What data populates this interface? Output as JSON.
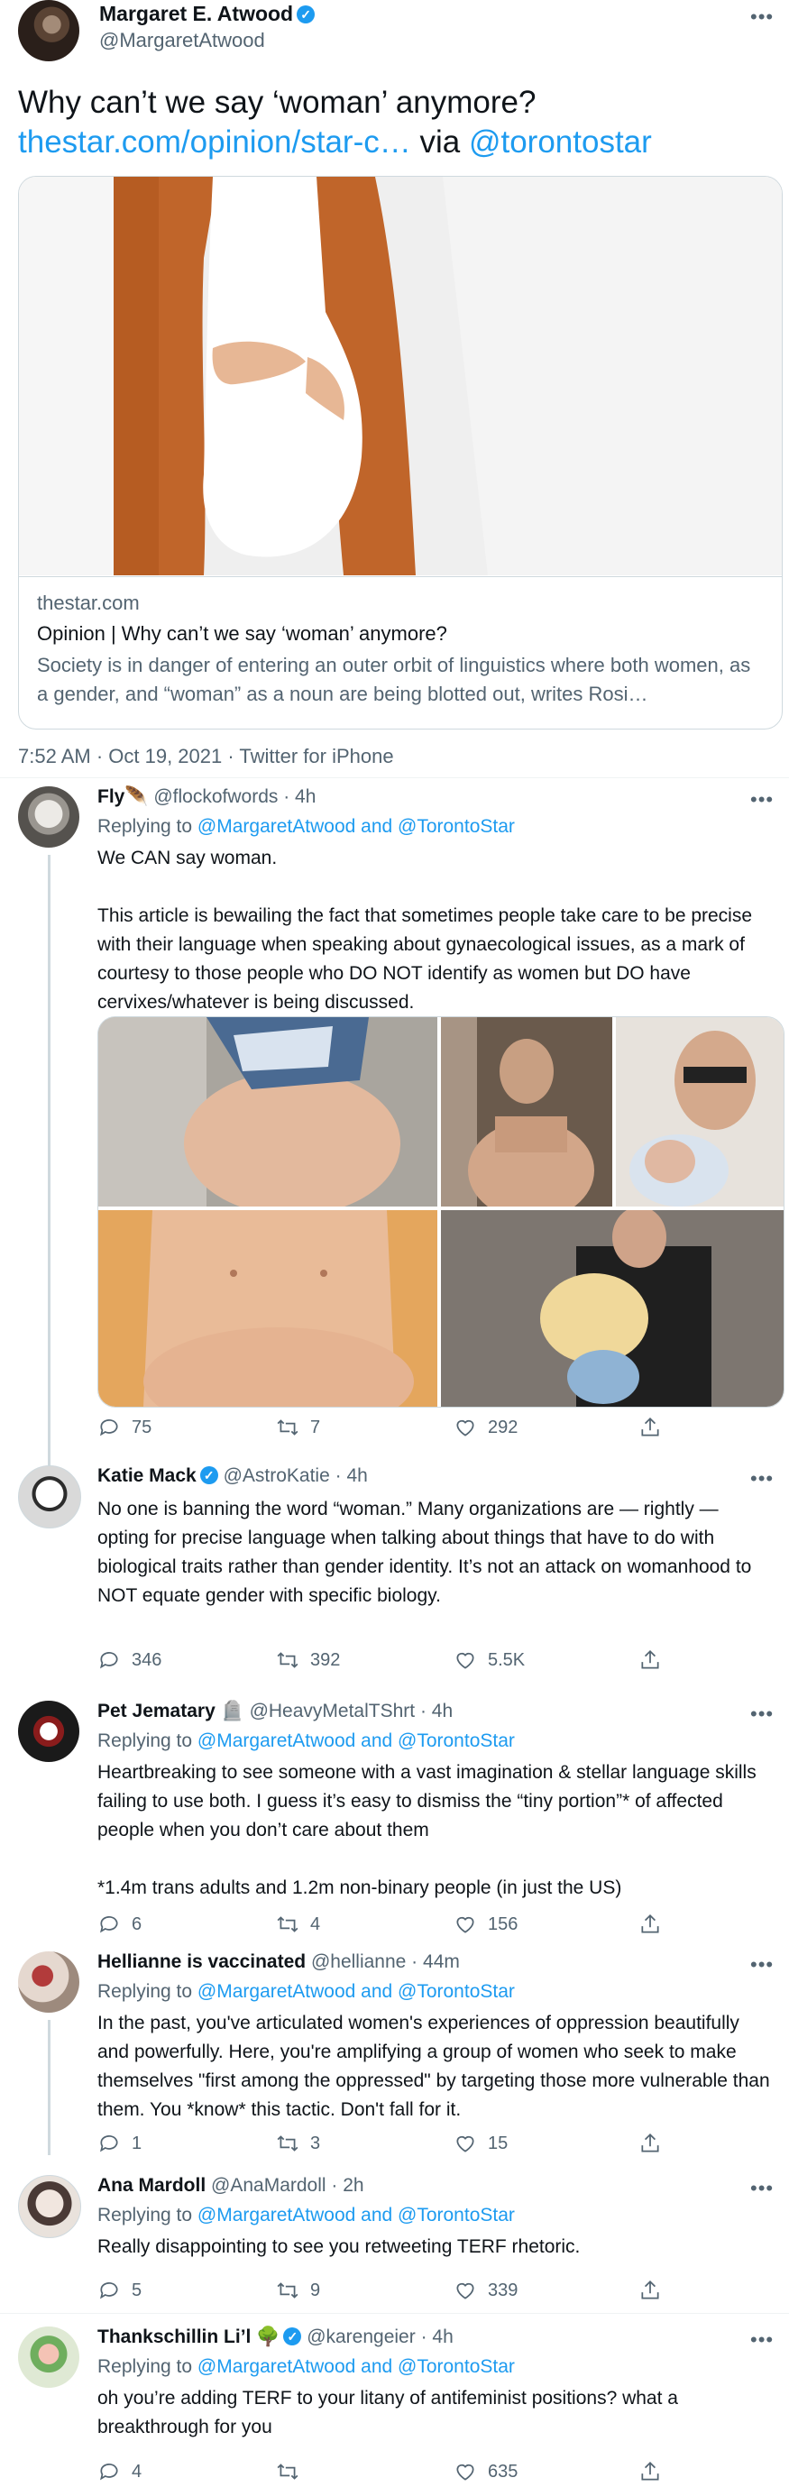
{
  "tweet": {
    "author_name": "Margaret E. Atwood",
    "author_handle": "@MargaretAtwood",
    "text": "Why can’t we say ‘woman’ anymore?",
    "link_text": "thestar.com/opinion/star-c…",
    "via_text": " via ",
    "via_handle": "@torontostar",
    "card": {
      "domain": "thestar.com",
      "title": "Opinion | Why can’t we say ‘woman’ anymore?",
      "description": "Society is in danger of entering an outer orbit of linguistics where both women, as a gender, and “woman” as a noun are being blotted out, writes Rosi…"
    },
    "timestamp": "7:52 AM · Oct 19, 2021 · Twitter for iPhone"
  },
  "replies": [
    {
      "name": "Fly🪶",
      "handle": "@flockofwords",
      "time": "4h",
      "replying_prefix": "Replying to ",
      "replying_to": "@MargaretAtwood and @TorontoStar",
      "text": "We CAN say woman.\n\nThis article is bewailing the fact that sometimes people take care to be precise with their language when speaking about gynaecological issues, as a mark of courtesy to those people who DO NOT identify as women but DO have cervixes/whatever is being discussed.",
      "replies": "75",
      "retweets": "7",
      "likes": "292"
    },
    {
      "name": "Katie Mack",
      "handle": "@AstroKatie",
      "time": "4h",
      "text": "No one is banning the word “woman.” Many organizations are — rightly — opting for precise language when talking about things that have to do with biological traits rather than gender identity. It’s not an attack on womanhood to NOT equate gender with specific biology.",
      "replies": "346",
      "retweets": "392",
      "likes": "5.5K"
    },
    {
      "name": "Pet Jematary 🪦",
      "handle": "@HeavyMetalTShrt",
      "time": "4h",
      "replying_prefix": "Replying to ",
      "replying_to": "@MargaretAtwood and @TorontoStar",
      "text": "Heartbreaking to see someone with a vast imagination & stellar language skills failing to use both. I guess it’s easy to dismiss the “tiny portion”* of affected people when you don’t care about them\n\n*1.4m trans adults and 1.2m non-binary people (in just the US)",
      "replies": "6",
      "retweets": "4",
      "likes": "156"
    },
    {
      "name": "Hellianne is vaccinated",
      "handle": "@hellianne",
      "time": "44m",
      "replying_prefix": "Replying to ",
      "replying_to": "@MargaretAtwood and @TorontoStar",
      "text": "In the past, you've articulated women's experiences of oppression beautifully and powerfully. Here, you're amplifying a group of women who seek to make themselves \"first among the oppressed\" by targeting those more vulnerable than them. You *know* this tactic. Don't fall for it.",
      "replies": "1",
      "retweets": "3",
      "likes": "15"
    },
    {
      "name": "Ana Mardoll",
      "handle": "@AnaMardoll",
      "time": "2h",
      "replying_prefix": "Replying to ",
      "replying_to": "@MargaretAtwood and @TorontoStar",
      "text": "Really disappointing to see you retweeting TERF rhetoric.",
      "replies": "5",
      "retweets": "9",
      "likes": "339"
    },
    {
      "name": "Thankschillin Li’l 🌳",
      "handle": "@karengeier",
      "time": "4h",
      "replying_prefix": "Replying to ",
      "replying_to": "@MargaretAtwood and @TorontoStar",
      "text": "oh you’re adding TERF to your litany of antifeminist positions? what a breakthrough for you",
      "replies": "4",
      "retweets": "",
      "likes": "635"
    }
  ],
  "colors": {
    "accent": "#1d9bf0",
    "secondary_text": "#536471",
    "border": "#cfd9de"
  },
  "icons": [
    "more-icon",
    "verified-icon",
    "reply-icon",
    "retweet-icon",
    "like-icon",
    "share-icon"
  ]
}
